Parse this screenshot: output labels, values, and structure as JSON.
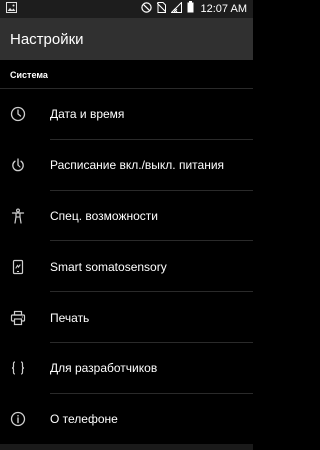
{
  "status_bar": {
    "time": "12:07 AM",
    "icons": [
      "image-icon",
      "dnd-icon",
      "no-sim-icon",
      "signal-icon",
      "battery-icon"
    ]
  },
  "app_bar": {
    "title": "Настройки"
  },
  "section": {
    "title": "Система",
    "items": [
      {
        "icon": "clock-icon",
        "label": "Дата и время"
      },
      {
        "icon": "power-schedule-icon",
        "label": "Расписание вкл./выкл. питания"
      },
      {
        "icon": "accessibility-icon",
        "label": "Спец. возможности"
      },
      {
        "icon": "gesture-phone-icon",
        "label": "Smart somatosensory"
      },
      {
        "icon": "print-icon",
        "label": "Печать"
      },
      {
        "icon": "developer-braces-icon",
        "label": "Для разработчиков"
      },
      {
        "icon": "info-icon",
        "label": "О телефоне"
      }
    ]
  },
  "colors": {
    "background": "#000000",
    "app_bar": "#303030",
    "status_bar": "#1d1d1d",
    "text": "#ffffff",
    "icon": "#cfcfcf"
  }
}
